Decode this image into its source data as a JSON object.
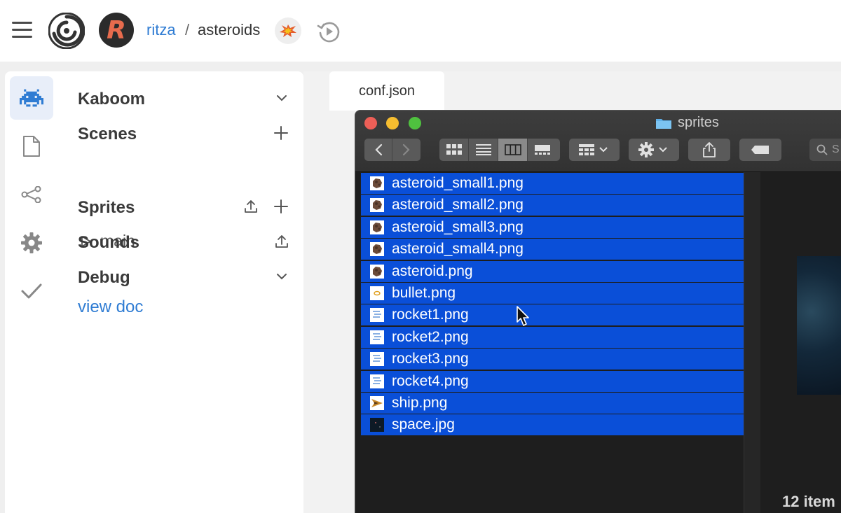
{
  "header": {
    "user": "ritza",
    "separator": "/",
    "repo": "asteroids",
    "avatar_letter": "R"
  },
  "sidebar": {
    "sections": {
      "kaboom": "Kaboom",
      "scenes": "Scenes",
      "main": "main",
      "sprites": "Sprites",
      "sounds": "Sounds",
      "debug": "Debug",
      "view_doc": "view doc"
    }
  },
  "editor": {
    "tabs": [
      {
        "label": "conf.json"
      }
    ]
  },
  "finder": {
    "title": "sprites",
    "search_placeholder": "S",
    "files": [
      {
        "name": "asteroid_small1.png",
        "icon": "asteroid-thumb"
      },
      {
        "name": "asteroid_small2.png",
        "icon": "asteroid-thumb"
      },
      {
        "name": "asteroid_small3.png",
        "icon": "asteroid-thumb"
      },
      {
        "name": "asteroid_small4.png",
        "icon": "asteroid-thumb"
      },
      {
        "name": "asteroid.png",
        "icon": "asteroid-thumb"
      },
      {
        "name": "bullet.png",
        "icon": "bullet-thumb"
      },
      {
        "name": "rocket1.png",
        "icon": "rocket-thumb"
      },
      {
        "name": "rocket2.png",
        "icon": "rocket-thumb"
      },
      {
        "name": "rocket3.png",
        "icon": "rocket-thumb"
      },
      {
        "name": "rocket4.png",
        "icon": "rocket-thumb"
      },
      {
        "name": "ship.png",
        "icon": "ship-thumb"
      },
      {
        "name": "space.jpg",
        "icon": "space-thumb"
      }
    ],
    "status": "12 item"
  },
  "colors": {
    "link": "#2f7cd3",
    "selection": "#0a4fd8",
    "rail_active": "#e8eef9"
  }
}
